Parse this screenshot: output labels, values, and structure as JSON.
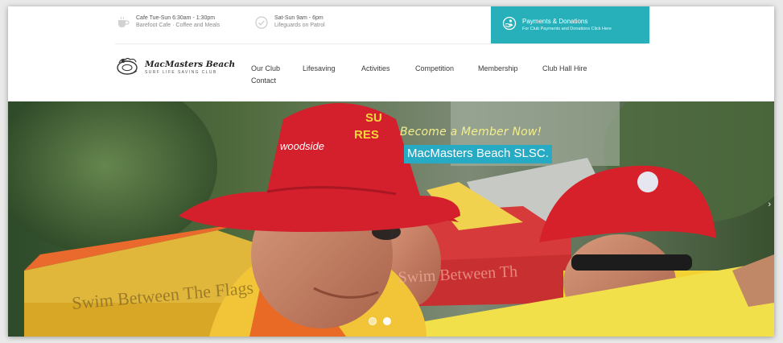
{
  "infobar": {
    "cafe": {
      "line1": "Cafe Tue-Sun 6:30am - 1:30pm",
      "line2": "Barefoot Cafe · Coffee and Meals"
    },
    "sat": {
      "line1": "Sat-Sun 9am - 6pm",
      "line2": "Lifeguards on Patrol"
    },
    "payments": {
      "title": "Payments & Donations",
      "subtitle": "For Club Payments and Donations Click Here",
      "color": "#27b0ba"
    }
  },
  "logo": {
    "name": "MacMasters Beach",
    "tagline": "SURF LIFE SAVING CLUB"
  },
  "nav": {
    "items": [
      "Our Club",
      "Lifesaving",
      "Activities",
      "Competition",
      "Membership",
      "Club Hall Hire",
      "Contact"
    ]
  },
  "hero": {
    "tagline": "Become a Member Now!",
    "title": "MacMasters Beach SLSC.",
    "title_bg": "#27aac4",
    "cap_text": "woodside",
    "cap_text2": "SU",
    "cap_text3": "RES",
    "banner_text": "Swim Between The Flags",
    "banner_text2": "Swim Between Th",
    "next_arrow": "›"
  },
  "slider": {
    "slide_count": 2,
    "active_index": 1
  },
  "icons": {
    "cafe": "coffee-cup-icon",
    "sat": "check-circle-icon",
    "payments": "donation-icon"
  }
}
